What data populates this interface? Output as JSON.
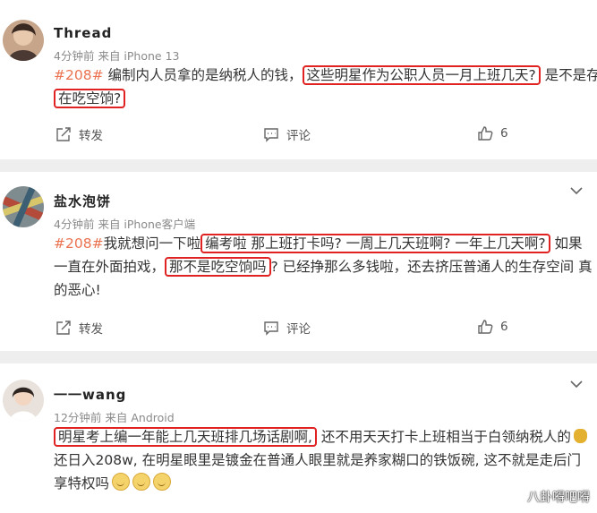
{
  "comments": [
    {
      "name": "Thread",
      "time": "4分钟前",
      "source": "来自 iPhone 13",
      "lines": [
        [
          {
            "t": "#208#",
            "tag": true
          },
          {
            "t": " 编制内人员拿的是纳税人的钱，"
          },
          {
            "t": "这些明星作为公职人员一月上班几天?",
            "hl": true
          },
          {
            "t": " 是不是存"
          }
        ],
        [
          {
            "t": "在吃空饷?",
            "hl": true
          }
        ]
      ],
      "actions": {
        "repost": "转发",
        "comment": "评论",
        "likes": "6"
      },
      "chevron": false
    },
    {
      "name": "盐水泡饼",
      "time": "4分钟前",
      "source": "来自 iPhone客户端",
      "lines": [
        [
          {
            "t": "#208#",
            "tag": true
          },
          {
            "t": "我就想问一下啦"
          },
          {
            "t": "编考啦 那上班打卡吗? 一周上几天班啊? 一年上几天啊?",
            "hl": true
          },
          {
            "t": " 如果"
          }
        ],
        [
          {
            "t": "一直在外面拍戏，"
          },
          {
            "t": "那不是吃空饷吗",
            "hl": true
          },
          {
            "t": "? 已经挣那么多钱啦，还去挤压普通人的生存空间 真"
          }
        ],
        [
          {
            "t": "的恶心!"
          }
        ]
      ],
      "actions": {
        "repost": "转发",
        "comment": "评论",
        "likes": "6"
      },
      "chevron": true
    },
    {
      "name": "一一wang",
      "time": "12分钟前",
      "source": "来自 Android",
      "lines": [
        [
          {
            "t": "明星考上编一年能上几天班排几场话剧啊,",
            "hl": true
          },
          {
            "t": " 还不用天天打卡上班相当于白领纳税人的"
          },
          {
            "emoji": "moneybag"
          }
        ],
        [
          {
            "t": "还日入208w, 在明星眼里是镀金在普通人眼里就是养家糊口的铁饭碗, 这不就是走后门"
          }
        ],
        [
          {
            "t": "享特权吗"
          },
          {
            "emoji": "smile"
          },
          {
            "emoji": "smile"
          },
          {
            "emoji": "smile"
          }
        ]
      ],
      "chevron": true
    }
  ],
  "watermark": "八卦嘚吧嘚",
  "colors": {
    "tag": "#eb7350",
    "highlight_border": "#e02222",
    "meta": "#8a8a8a",
    "separator": "#eeeeee"
  },
  "icons": [
    "repost-icon",
    "comment-icon",
    "like-icon",
    "chevron-down-icon",
    "moneybag-emoji",
    "smile-emoji"
  ]
}
